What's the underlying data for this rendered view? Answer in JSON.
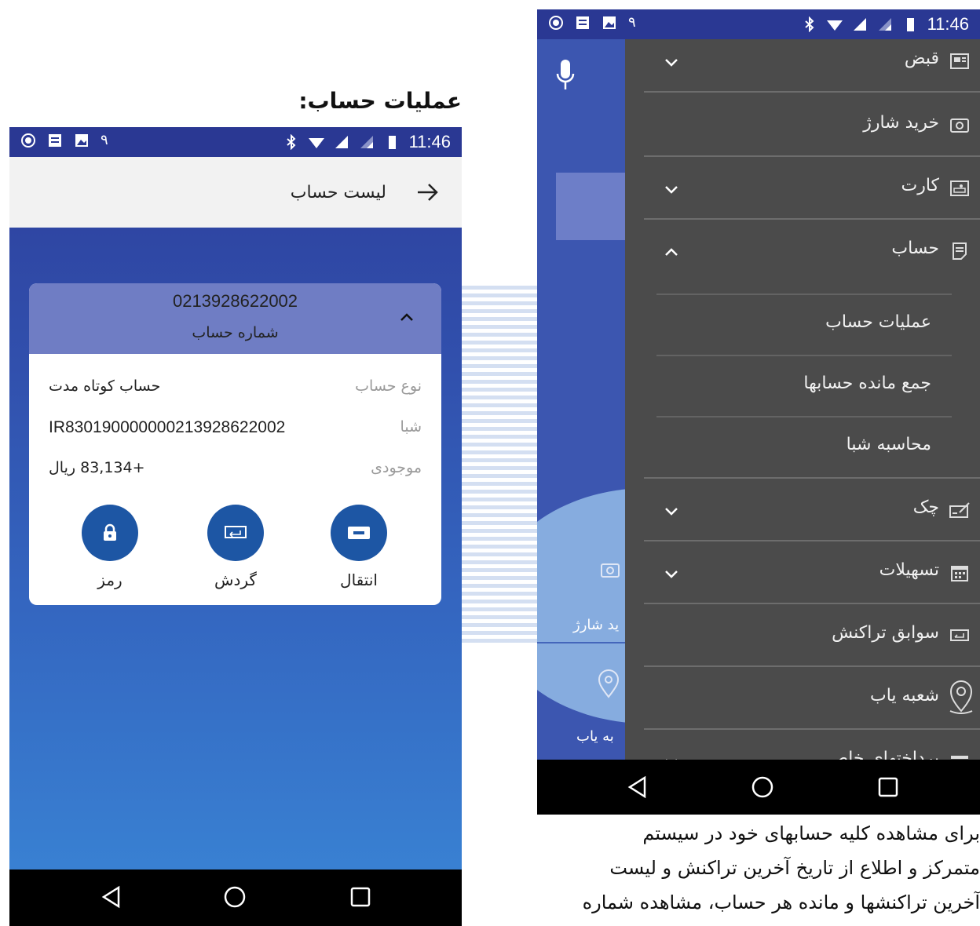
{
  "heading": "عملیات حساب:",
  "left": {
    "status": {
      "time": "11:46",
      "digit": "۹"
    },
    "appbar": {
      "title": "لیست حساب"
    },
    "card": {
      "account_number": "0213928622002",
      "account_number_label": "شماره حساب",
      "rows": [
        {
          "label": "نوع حساب",
          "value": "حساب کوتاه مدت"
        },
        {
          "label": "شبا",
          "value": "IR830190000000213928622002"
        },
        {
          "label": "موجودی",
          "value": "+83,134 ریال"
        }
      ],
      "actions": [
        {
          "label": "انتقال",
          "icon": "transfer-icon"
        },
        {
          "label": "گردش",
          "icon": "turnover-icon"
        },
        {
          "label": "رمز",
          "icon": "lock-icon"
        }
      ]
    }
  },
  "right": {
    "status": {
      "time": "11:46",
      "digit": "۹"
    },
    "background_labels": {
      "charge": "ید شارژ",
      "branch": "به یاب"
    },
    "drawer": {
      "items": [
        {
          "label": "قبض",
          "icon": "bill-icon",
          "expandable": true,
          "expanded": false
        },
        {
          "label": "خرید شارژ",
          "icon": "charge-icon",
          "expandable": false
        },
        {
          "label": "کارت",
          "icon": "card-icon",
          "expandable": true,
          "expanded": false
        },
        {
          "label": "حساب",
          "icon": "account-icon",
          "expandable": true,
          "expanded": true
        },
        {
          "label": "چک",
          "icon": "cheque-icon",
          "expandable": true,
          "expanded": false
        },
        {
          "label": "تسهیلات",
          "icon": "calendar-icon",
          "expandable": true,
          "expanded": false
        },
        {
          "label": "سوابق تراکنش",
          "icon": "transactions-icon",
          "expandable": false
        },
        {
          "label": "شعبه یاب",
          "icon": "location-icon",
          "expandable": false
        },
        {
          "label": "پرداختهای خاص",
          "icon": "payment-icon",
          "expandable": true,
          "expanded": false
        }
      ],
      "sub_items": [
        {
          "label": "عملیات حساب"
        },
        {
          "label": "جمع مانده حسابها"
        },
        {
          "label": "محاسبه شبا"
        }
      ]
    }
  },
  "caption": [
    "برای مشاهده کلیه حسابهای خود در سیستم",
    "متمرکز و اطلاع از تاریخ آخرین تراکنش و لیست",
    "آخرین تراکنشها و مانده هر حساب، مشاهده شماره"
  ],
  "colors": {
    "primary": "#1d56a4",
    "statusbar": "#2a3893",
    "drawer": "#4b4b4b",
    "card_header": "#6f7dc4"
  }
}
